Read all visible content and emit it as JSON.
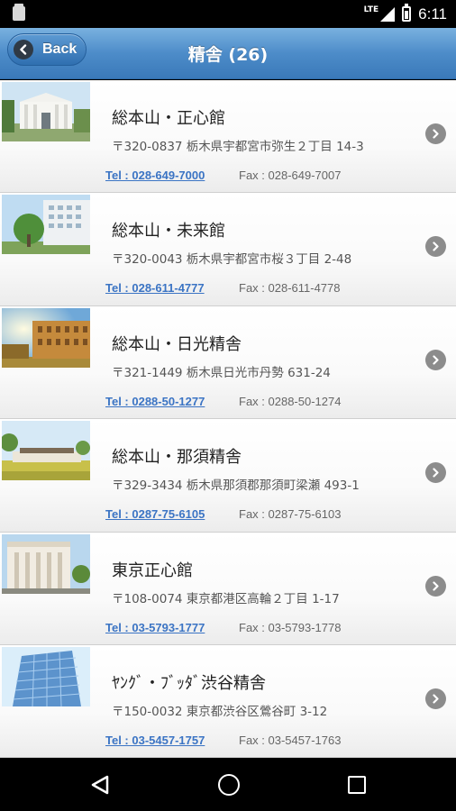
{
  "status_bar": {
    "network": "LTE",
    "time": "6:11"
  },
  "header": {
    "back_label": "Back",
    "title": "精舎 (26)"
  },
  "items": [
    {
      "name": "総本山・正心館",
      "address": "〒320-0837 栃木県宇都宮市弥生２丁目 14-3",
      "tel": "Tel : 028-649-7000",
      "fax": "Fax : 028-649-7007",
      "thumb_icon": "white-pavilion-building"
    },
    {
      "name": "総本山・未来館",
      "address": "〒320-0043 栃木県宇都宮市桜３丁目 2-48",
      "tel": "Tel : 028-611-4777",
      "fax": "Fax : 028-611-4778",
      "thumb_icon": "modern-building-with-tree"
    },
    {
      "name": "総本山・日光精舎",
      "address": "〒321-1449 栃木県日光市丹勢 631-24",
      "tel": "Tel : 0288-50-1277",
      "fax": "Fax : 0288-50-1274",
      "thumb_icon": "sunlit-brick-building"
    },
    {
      "name": "総本山・那須精舎",
      "address": "〒329-3434 栃木県那須郡那須町梁瀬 493-1",
      "tel": "Tel : 0287-75-6105",
      "fax": "Fax : 0287-75-6103",
      "thumb_icon": "lawn-building"
    },
    {
      "name": "東京正心館",
      "address": "〒108-0074 東京都港区高輪２丁目 1-17",
      "tel": "Tel : 03-5793-1777",
      "fax": "Fax : 03-5793-1778",
      "thumb_icon": "columned-building"
    },
    {
      "name": "ﾔﾝｸﾞ・ﾌﾞｯﾀﾞ渋谷精舎",
      "address": "〒150-0032 東京都渋谷区鶯谷町 3-12",
      "tel": "Tel : 03-5457-1757",
      "fax": "Fax : 03-5457-1763",
      "thumb_icon": "glass-tower"
    }
  ],
  "nav_bar": {
    "back": "nav-back-icon",
    "home": "nav-home-icon",
    "recents": "nav-recents-icon"
  }
}
